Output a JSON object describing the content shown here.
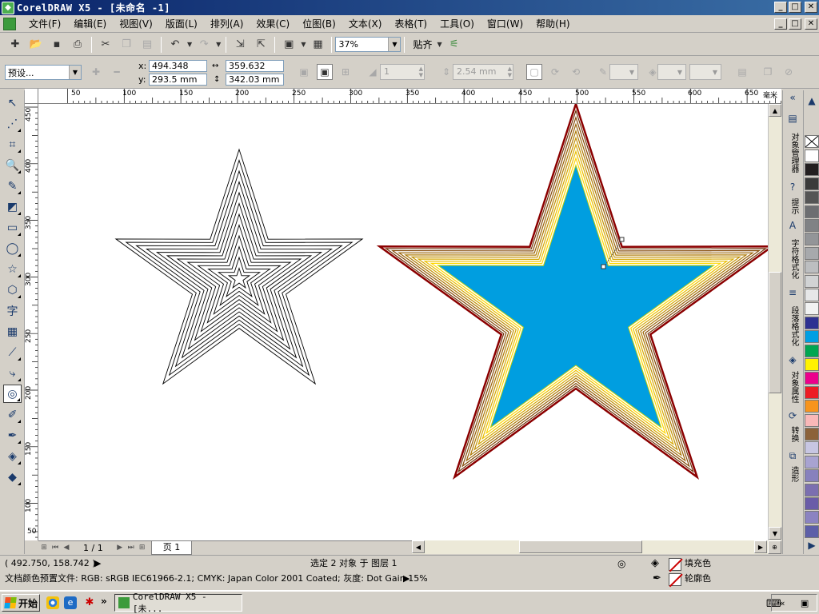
{
  "window": {
    "title": "CorelDRAW X5 - [未命名 -1]",
    "buttons": {
      "minimize": "_",
      "maximize": "□",
      "close": "✕"
    }
  },
  "menu": {
    "items": [
      "文件(F)",
      "编辑(E)",
      "视图(V)",
      "版面(L)",
      "排列(A)",
      "效果(C)",
      "位图(B)",
      "文本(X)",
      "表格(T)",
      "工具(O)",
      "窗口(W)",
      "帮助(H)"
    ]
  },
  "toolbar": {
    "zoom_value": "37%",
    "snap_label": "贴齐",
    "icons": [
      "new-icon",
      "open-icon",
      "save-icon",
      "print-icon",
      "cut-icon",
      "copy-icon",
      "paste-icon",
      "undo-icon",
      "redo-icon",
      "import-icon",
      "export-icon",
      "launcher-icon",
      "welcome-icon"
    ]
  },
  "property_bar": {
    "preset": "预设...",
    "x_label": "x:",
    "x_value": "494.348 mm",
    "y_label": "y:",
    "y_value": "293.5 mm",
    "width_value": "359.632 mm",
    "height_value": "342.03 mm",
    "steps_value": "1",
    "offset_value": "2.54 mm"
  },
  "ruler": {
    "unit": "毫米",
    "h_labels": [
      "50",
      "100",
      "150",
      "200",
      "250",
      "300",
      "350",
      "400",
      "450",
      "500",
      "550",
      "600",
      "650"
    ],
    "v_labels": [
      "450",
      "400",
      "350",
      "300",
      "250",
      "200",
      "150",
      "100",
      "50"
    ]
  },
  "page_nav": {
    "count": "1 / 1",
    "tab": "页 1"
  },
  "dockers": {
    "tabs": [
      "对象管理器",
      "提示",
      "字符格式化",
      "段落格式化",
      "对象属性",
      "转换",
      "造形"
    ]
  },
  "palette": {
    "colors": [
      "#ffffff",
      "#231f20",
      "#3a3a3a",
      "#555555",
      "#6d6e71",
      "#808285",
      "#939598",
      "#a7a9ac",
      "#bcbec0",
      "#d1d3d4",
      "#e6e7e8",
      "#f1f2f2",
      "#2e3192",
      "#009fe3",
      "#00a651",
      "#fff200",
      "#ec008c",
      "#ed1c24",
      "#f7941d",
      "#f9b8b8",
      "#8c6239",
      "#c7c6e2",
      "#a8a3d1",
      "#8781bd",
      "#7b6fb0",
      "#6a5ca8",
      "#8b83c1",
      "#5d5fa8"
    ]
  },
  "status": {
    "coords": "( 492.750, 158.742 )",
    "selection": "选定 2 对象 于 图层 1",
    "color_profile": "文档颜色预置文件: RGB: sRGB IEC61966-2.1; CMYK: Japan Color 2001 Coated; 灰度: Dot Gain 15%",
    "fill_label": "填充色",
    "outline_label": "轮廓色"
  },
  "taskbar": {
    "start": "开始",
    "more": "»",
    "task_title": "CorelDRAW X5 - [未...",
    "tray_arrow": "«"
  },
  "colors": {
    "star_fill": "#009ee0",
    "star_outline": "#8b0000",
    "blend_start": "#5a1a0a",
    "blend_end": "#ffd700",
    "title_blue": "#0a246a"
  }
}
